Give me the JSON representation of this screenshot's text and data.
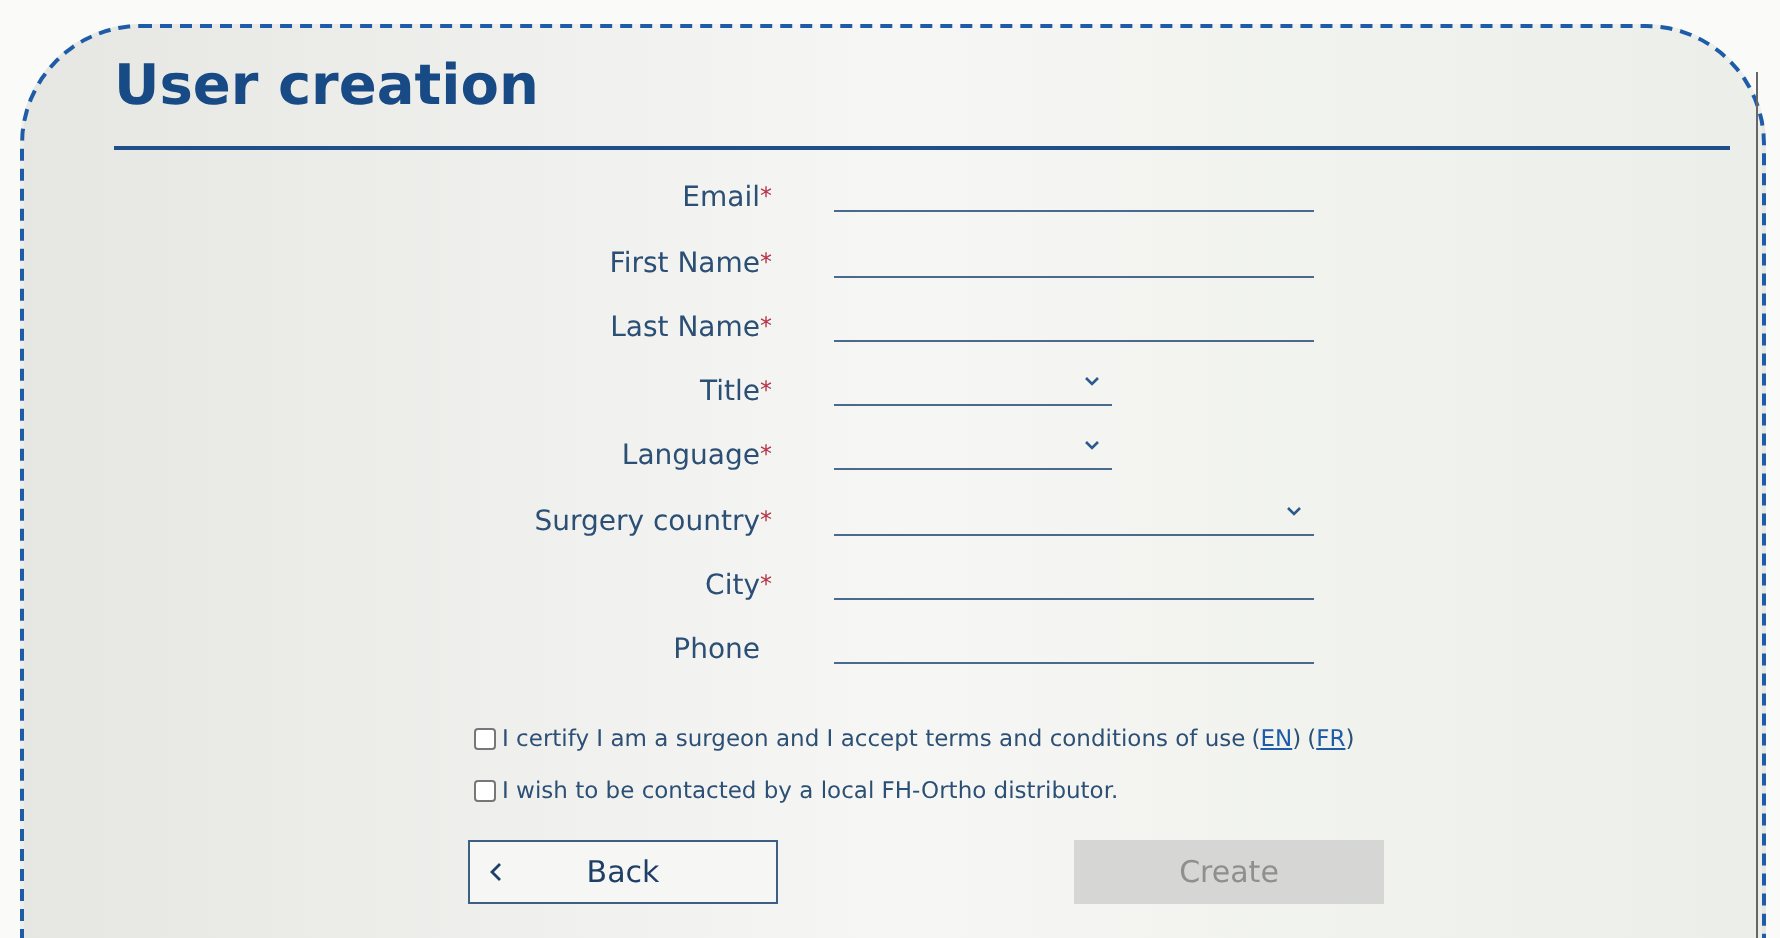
{
  "title": "User creation",
  "fields": [
    {
      "label": "Email",
      "required": true,
      "kind": "text"
    },
    {
      "label": "First Name",
      "required": true,
      "kind": "text"
    },
    {
      "label": "Last Name",
      "required": true,
      "kind": "text"
    },
    {
      "label": "Title",
      "required": true,
      "kind": "short-select"
    },
    {
      "label": "Language",
      "required": true,
      "kind": "short-select"
    },
    {
      "label": "Surgery country",
      "required": true,
      "kind": "select"
    },
    {
      "label": "City",
      "required": true,
      "kind": "text"
    },
    {
      "label": "Phone",
      "required": false,
      "kind": "text"
    }
  ],
  "required_mark": "*",
  "checkboxes": [
    {
      "text": "I certify I am a surgeon and I accept terms and conditions of use",
      "links": [
        {
          "open": "(",
          "label": "EN",
          "close": ")"
        },
        {
          "open": "(",
          "label": "FR",
          "close": ")"
        }
      ],
      "checked": false
    },
    {
      "text": "I wish to be contacted by a local FH-Ortho distributor.",
      "checked": false
    }
  ],
  "buttons": [
    {
      "label": "Back",
      "kind": "back",
      "disabled": false
    },
    {
      "label": "Create",
      "kind": "primary",
      "disabled": true
    }
  ]
}
